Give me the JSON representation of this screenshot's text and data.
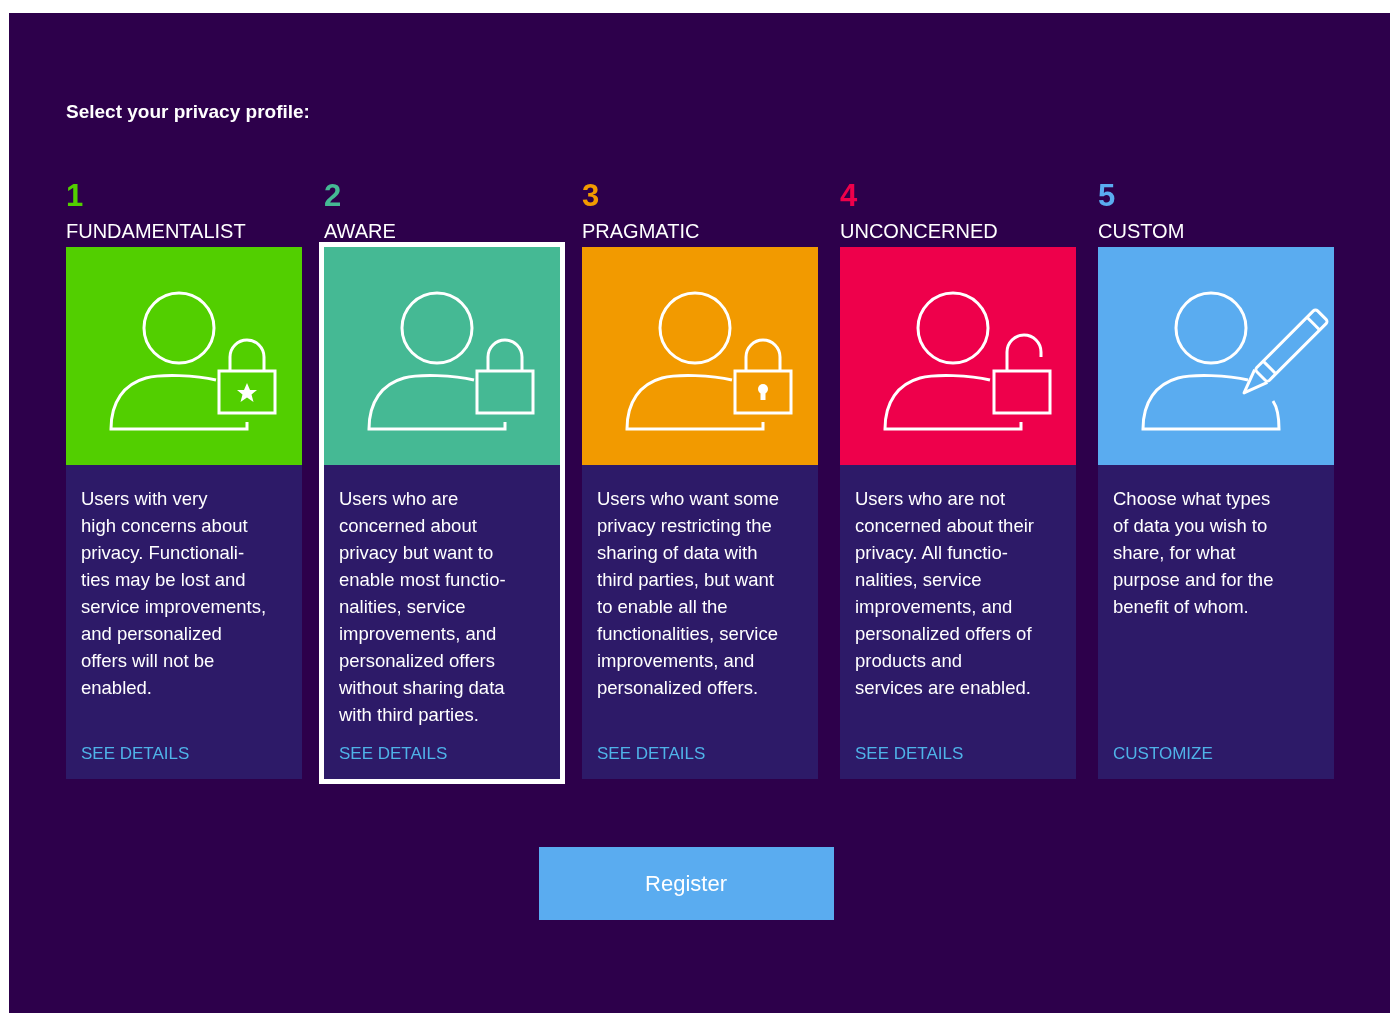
{
  "heading": "Select your privacy profile:",
  "profiles": [
    {
      "number": "1",
      "label": "FUNDAMENTALIST",
      "color": "#52cf00",
      "kind": "lock-star",
      "selected": false,
      "description": "Users with very\nhigh concerns about\nprivacy.  Functionali-\nties may be lost and\nservice improvements,\nand personalized\noffers will not be\nenabled.",
      "link": "SEE DETAILS"
    },
    {
      "number": "2",
      "label": "AWARE",
      "color": "#45b994",
      "kind": "lock",
      "selected": true,
      "description": "Users who are\nconcerned about\nprivacy but want to\nenable most functio-\nnalities, service\nimprovements, and\npersonalized offers\nwithout sharing data\nwith third parties.",
      "link": "SEE DETAILS"
    },
    {
      "number": "3",
      "label": "PRAGMATIC",
      "color": "#f29a00",
      "kind": "lock-keyhole",
      "selected": false,
      "description": "Users who want some\nprivacy restricting the\nsharing of data with\nthird parties, but want\nto enable all the\nfunctionalities, service\nimprovements, and\npersonalized offers.",
      "link": "SEE DETAILS"
    },
    {
      "number": "4",
      "label": "UNCONCERNED",
      "color": "#ee004b",
      "kind": "lock-open",
      "selected": false,
      "description": "Users who are not\nconcerned about their\nprivacy. All functio-\nnalities, service\nimprovements, and\npersonalized offers of\nproducts and\nservices are enabled.",
      "link": "SEE DETAILS"
    },
    {
      "number": "5",
      "label": "CUSTOM",
      "color": "#5aacf0",
      "kind": "pencil",
      "selected": false,
      "description": "Choose what types\nof data you wish to\nshare, for what\npurpose and for the\nbenefit of whom.",
      "link": "CUSTOMIZE"
    }
  ],
  "button": "Register"
}
